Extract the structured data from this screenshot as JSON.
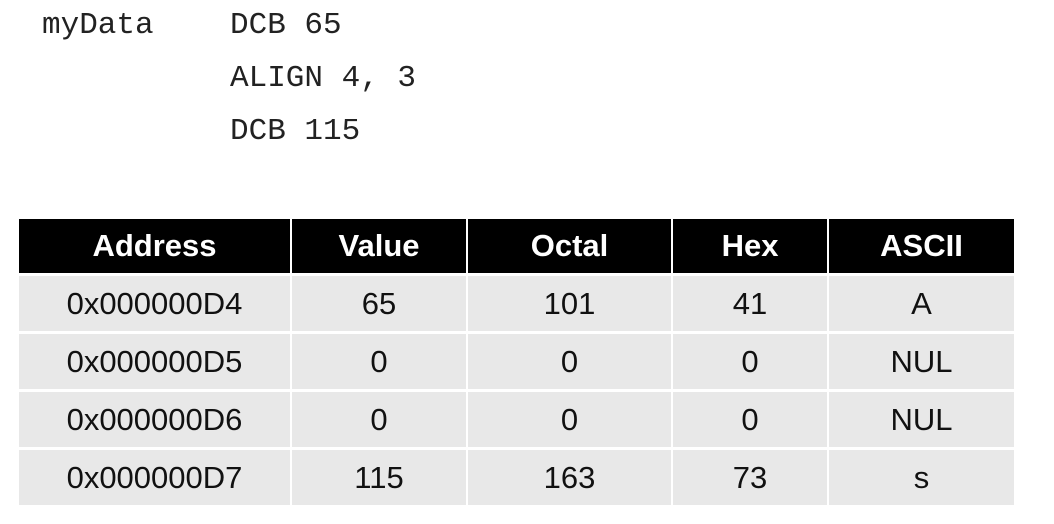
{
  "code": {
    "lines": [
      {
        "label": "myData",
        "instruction": "DCB 65"
      },
      {
        "label": "",
        "instruction": "ALIGN 4, 3"
      },
      {
        "label": "",
        "instruction": "DCB 115"
      }
    ]
  },
  "table": {
    "headers": [
      "Address",
      "Value",
      "Octal",
      "Hex",
      "ASCII"
    ],
    "rows": [
      [
        "0x000000D4",
        "65",
        "101",
        "41",
        "A"
      ],
      [
        "0x000000D5",
        "0",
        "0",
        "0",
        "NUL"
      ],
      [
        "0x000000D6",
        "0",
        "0",
        "0",
        "NUL"
      ],
      [
        "0x000000D7",
        "115",
        "163",
        "73",
        "s"
      ]
    ]
  }
}
